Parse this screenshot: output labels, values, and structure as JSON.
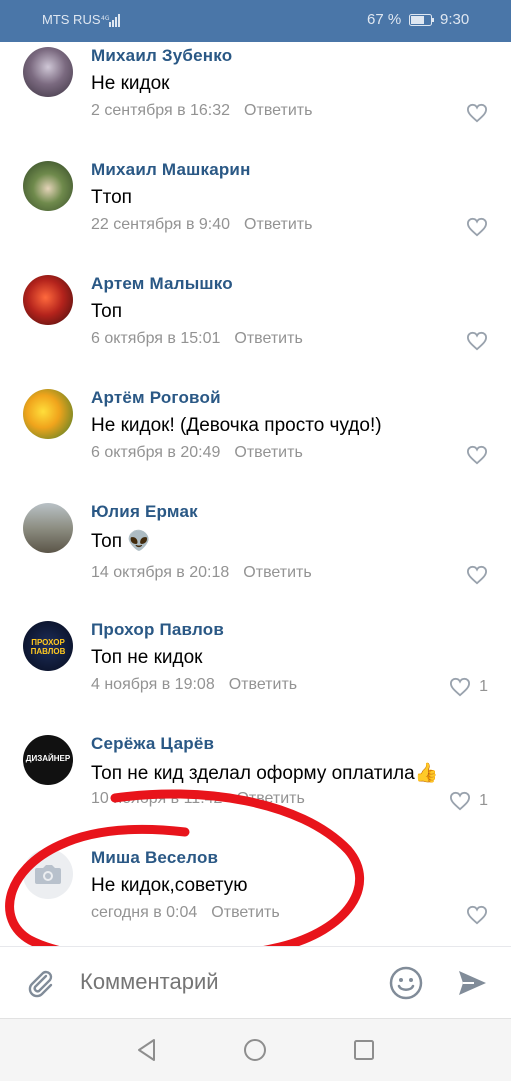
{
  "status_bar": {
    "carrier": "MTS RUS",
    "battery_percent": "67 %",
    "time": "9:30"
  },
  "comments": [
    {
      "name": "Михаил Зубенко",
      "text": "Не кидок",
      "date": "2 сентября в 16:32",
      "reply": "Ответить",
      "likes": "",
      "avatar_color": "#6b5a6e"
    },
    {
      "name": "Михаил Машкарин",
      "text": "Ттоп",
      "date": "22 сентября в 9:40",
      "reply": "Ответить",
      "likes": "",
      "avatar_color": "#4d6b3a"
    },
    {
      "name": "Артем Малышко",
      "text": "Топ",
      "date": "6 октября в 15:01",
      "reply": "Ответить",
      "likes": "",
      "avatar_color": "#a8231f"
    },
    {
      "name": "Артём Роговой",
      "text": "Не кидок! (Девочка просто чудо!)",
      "date": "6 октября в 20:49",
      "reply": "Ответить",
      "likes": "",
      "avatar_color": "#f2c21a"
    },
    {
      "name": "Юлия Ермак",
      "text": "Топ 👽",
      "date": "14 октября в 20:18",
      "reply": "Ответить",
      "likes": "",
      "avatar_color": "#8a8a7a"
    },
    {
      "name": "Прохор Павлов",
      "text": "Топ не кидок",
      "date": "4 ноября в 19:08",
      "reply": "Ответить",
      "likes": "1",
      "avatar_color": "#0d1630",
      "avatar_label": "ПРОХОР ПАВЛОВ"
    },
    {
      "name": "Серёжа Царёв",
      "text": "Топ не кид зделал оформу оплатила👍",
      "date": "10 ноября в 11:42",
      "reply": "Ответить",
      "likes": "1",
      "avatar_color": "#111111",
      "avatar_label": "ДИЗАЙНЕР"
    },
    {
      "name": "Миша Веселов",
      "text": "Не кидок,советую",
      "date": "сегодня в 0:04",
      "reply": "Ответить",
      "likes": "",
      "avatar_color": "#eceef1"
    }
  ],
  "composer": {
    "placeholder": "Комментарий"
  },
  "icons": {
    "attach": "paperclip-icon",
    "emoji": "smile-icon",
    "send": "send-icon",
    "like": "heart-icon",
    "camera": "camera-icon"
  },
  "colors": {
    "header": "#4a76a8",
    "author_name": "#2a5885",
    "annotation_stroke": "#e8141b"
  }
}
